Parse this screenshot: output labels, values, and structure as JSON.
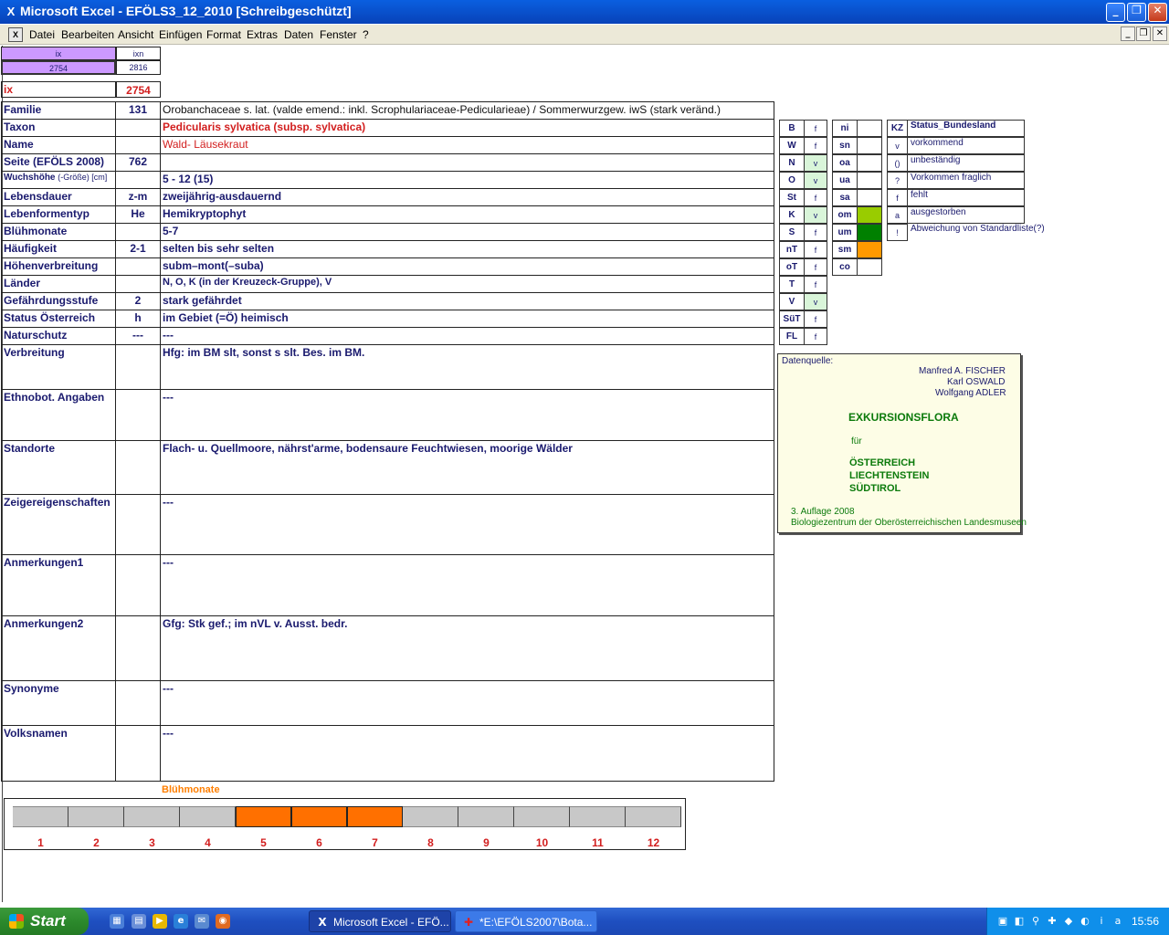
{
  "window": {
    "title": "Microsoft Excel - EFÖLS3_12_2010  [Schreibgeschützt]"
  },
  "menu": [
    "Datei",
    "Bearbeiten",
    "Ansicht",
    "Einfügen",
    "Format",
    "Extras",
    "Daten",
    "Fenster",
    "?"
  ],
  "header_block": {
    "ix_label": "ix",
    "ixn_label": "ixn",
    "ix_value": "2754",
    "ixn_value": "2816",
    "ix_big_label": "ix",
    "ix_big_value": "2754"
  },
  "rows": [
    {
      "label": "Familie",
      "mid": "131",
      "value": "Orobanchaceae s. lat. (valde emend.: inkl. Scrophulariaceae-Pedicularieae)  /  Sommerwurzgew. iwS (stark veränd.)"
    },
    {
      "label": "Taxon",
      "mid": "",
      "value": "Pedicularis sylvatica (subsp. sylvatica)"
    },
    {
      "label": "Name",
      "mid": "",
      "value": "Wald- Läusekraut"
    },
    {
      "label": "Seite (EFÖLS 2008)",
      "mid": "762",
      "value": ""
    },
    {
      "label": "Wuchshöhe",
      "label_sub": "(-Größe) [cm]",
      "mid": "",
      "value": "5 - 12 (15)"
    },
    {
      "label": "Lebensdauer",
      "mid": "z-m",
      "value": "zweijährig-ausdauernd"
    },
    {
      "label": "Lebenformentyp",
      "mid": "He",
      "value": "Hemikryptophyt"
    },
    {
      "label": "Blühmonate",
      "mid": "",
      "value": "5-7"
    },
    {
      "label": "Häufigkeit",
      "mid": "2-1",
      "value": "selten bis sehr selten"
    },
    {
      "label": "Höhenverbreitung",
      "mid": "",
      "value": "subm–mont(–suba)"
    },
    {
      "label": "Länder",
      "mid": "",
      "value": "N, O, K (in der Kreuzeck-Gruppe), V"
    },
    {
      "label": "Gefährdungsstufe",
      "mid": "2",
      "value": "stark gefährdet"
    },
    {
      "label": "Status Österreich",
      "mid": "h",
      "value": "im Gebiet (=Ö) heimisch"
    },
    {
      "label": "Naturschutz",
      "mid": "---",
      "value": "---"
    },
    {
      "label": "Verbreitung",
      "mid": "",
      "value": "Hfg:  im BM slt, sonst s slt. Bes. im BM."
    },
    {
      "label": "Ethnobot. Angaben",
      "mid": "",
      "value": "---"
    },
    {
      "label": "Standorte",
      "mid": "",
      "value": "Flach- u. Quellmoore, nährst'arme, bodensaure Feuchtwiesen, moorige Wälder"
    },
    {
      "label": "Zeigereigenschaften",
      "mid": "",
      "value": "---"
    },
    {
      "label": "Anmerkungen1",
      "mid": "",
      "value": "---"
    },
    {
      "label": "Anmerkungen2",
      "mid": "",
      "value": "Gfg: Stk gef.; im nVL v. Ausst. bedr."
    },
    {
      "label": "Synonyme",
      "mid": "",
      "value": "---"
    },
    {
      "label": "Volksnamen",
      "mid": "",
      "value": "---"
    }
  ],
  "laender_grid": [
    {
      "code": "B",
      "flag": "f"
    },
    {
      "code": "W",
      "flag": "f"
    },
    {
      "code": "N",
      "flag": "v"
    },
    {
      "code": "O",
      "flag": "v"
    },
    {
      "code": "St",
      "flag": "f"
    },
    {
      "code": "K",
      "flag": "v"
    },
    {
      "code": "S",
      "flag": "f"
    },
    {
      "code": "nT",
      "flag": "f"
    },
    {
      "code": "oT",
      "flag": "f"
    },
    {
      "code": "T",
      "flag": "f"
    },
    {
      "code": "V",
      "flag": "v"
    },
    {
      "code": "SüT",
      "flag": "f"
    },
    {
      "code": "FL",
      "flag": "f"
    }
  ],
  "hoehen_grid": [
    "ni",
    "sn",
    "oa",
    "ua",
    "sa",
    "om",
    "um",
    "sm",
    "co"
  ],
  "hoehen_colors": {
    "om": "#99cc00",
    "um": "#008000",
    "sm": "#ff9900"
  },
  "legend": {
    "header_kz": "KZ",
    "header_title": "Status_Bundesland",
    "items": [
      {
        "kz": "v",
        "text": "vorkommend"
      },
      {
        "kz": "()",
        "text": "unbeständig"
      },
      {
        "kz": "?",
        "text": "Vorkommen fraglich"
      },
      {
        "kz": "f",
        "text": "fehlt"
      },
      {
        "kz": "a",
        "text": "ausgestorben"
      },
      {
        "kz": "!",
        "text": "Abweichung von Standardliste(?)"
      }
    ]
  },
  "source": {
    "label": "Datenquelle:",
    "authors": [
      "Manfred A. FISCHER",
      "Karl OSWALD",
      "Wolfgang ADLER"
    ],
    "book": "EXKURSIONSFLORA",
    "fuer": "für",
    "regions": [
      "ÖSTERREICH",
      "LIECHTENSTEIN",
      "SÜDTIROL"
    ],
    "edition": "3. Auflage 2008",
    "publisher": "Biologiezentrum der Oberösterreichischen Landesmuseen"
  },
  "bloom": {
    "title": "Blühmonate",
    "months": [
      "1",
      "2",
      "3",
      "4",
      "5",
      "6",
      "7",
      "8",
      "9",
      "10",
      "11",
      "12"
    ],
    "active": [
      5,
      6,
      7
    ],
    "color_on": "#ff7000",
    "color_off": "#c8c8c8"
  },
  "taskbar": {
    "start": "Start",
    "tasks": [
      "Microsoft Excel - EFÖ...",
      "*E:\\EFÖLS2007\\Bota..."
    ],
    "clock": "15:56"
  }
}
